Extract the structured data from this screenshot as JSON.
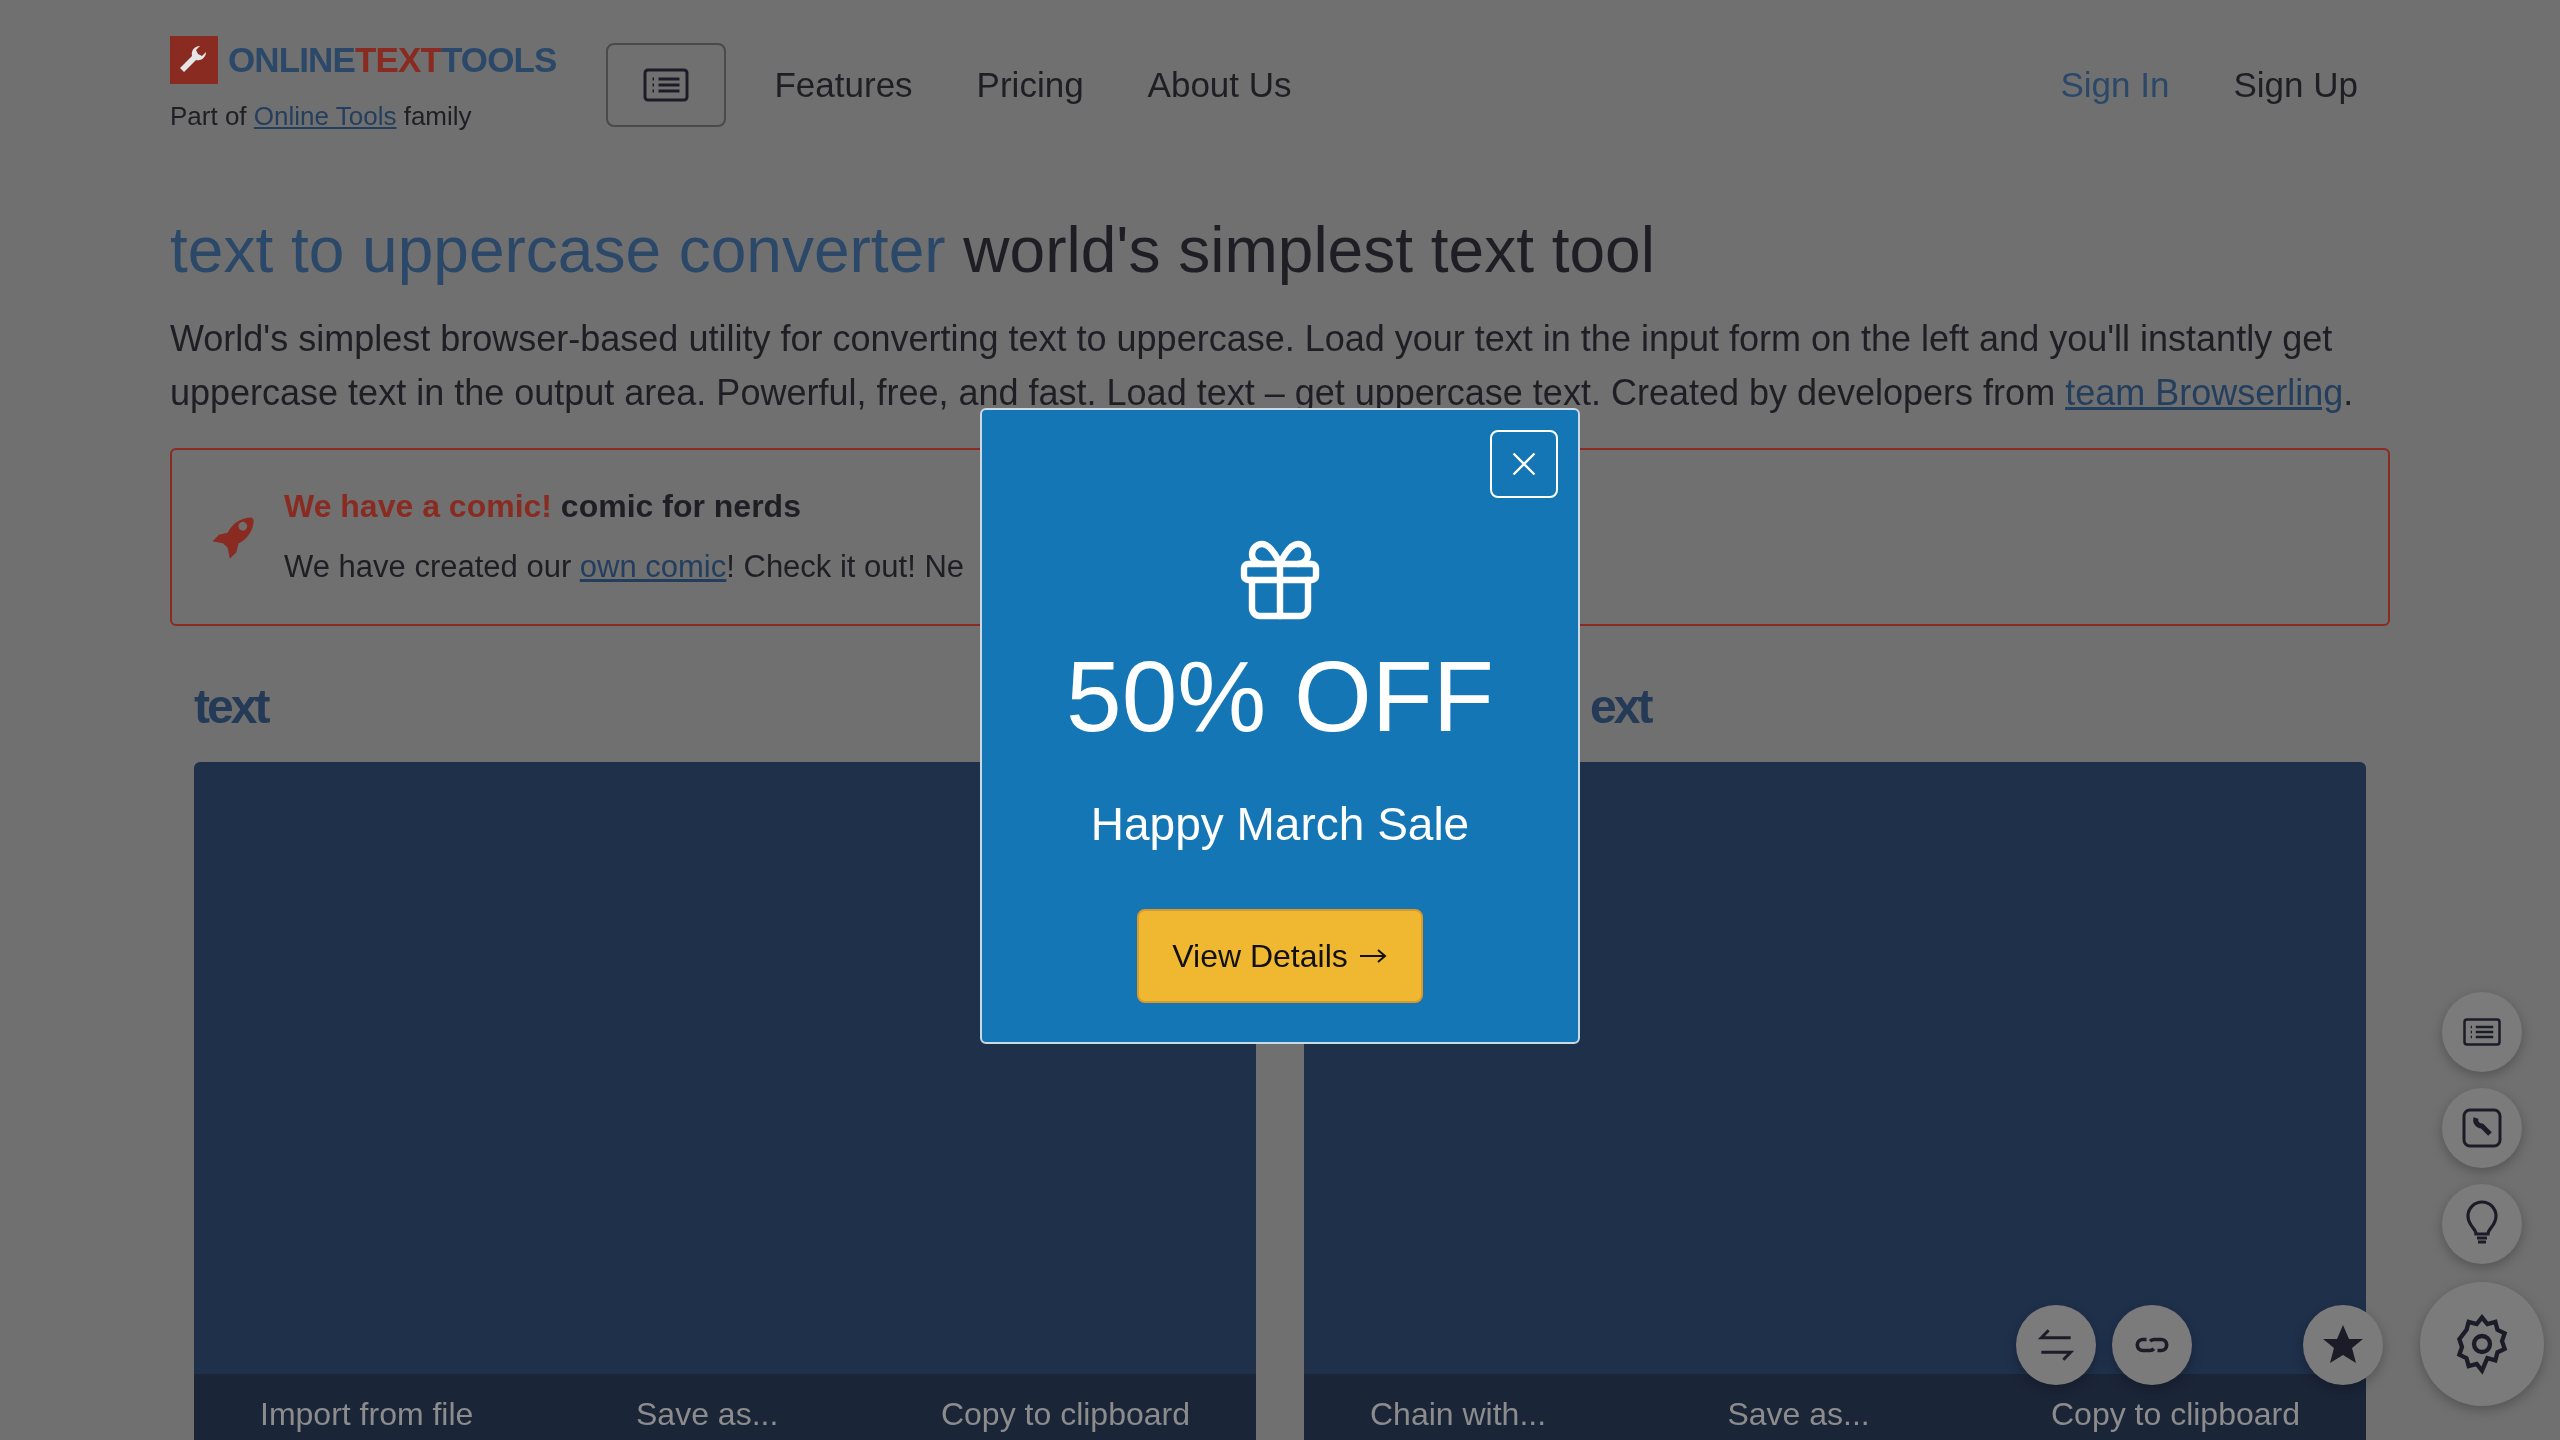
{
  "header": {
    "logo": [
      {
        "text": "ONLINE",
        "color": "#2b4869"
      },
      {
        "text": "TEXT",
        "color": "#8a2b22"
      },
      {
        "text": "TOOLS",
        "color": "#2b4869"
      }
    ],
    "family": {
      "before": "Part of ",
      "link": "Online Tools",
      "after": " family"
    },
    "nav": [
      "Features",
      "Pricing",
      "About Us"
    ],
    "auth": [
      {
        "label": "Sign In",
        "kind": "link"
      },
      {
        "label": "Sign Up",
        "kind": "plain"
      }
    ]
  },
  "title": {
    "highlight": "text to uppercase converter",
    "rest": "world's simplest text tool"
  },
  "description": {
    "before": "World's simplest browser-based utility for converting text to uppercase. Load your text in the input form on the left and you'll instantly get uppercase text in the output area. Powerful, free, and fast. Load text – get uppercase text. Created by developers from ",
    "link": "team Browserling",
    "after": "."
  },
  "banner": {
    "title": "We have a comic!",
    "subtitle": "comic for nerds",
    "before": "We have created our ",
    "link": "own comic",
    "after": "! Check it out! Ne"
  },
  "panels": [
    {
      "heading": "text",
      "actions": [
        "Import from file",
        "Save as...",
        "Copy to clipboard"
      ]
    },
    {
      "heading": "ext",
      "actions": [
        "Chain with...",
        "Save as...",
        "Copy to clipboard"
      ]
    }
  ],
  "modal": {
    "discount": "50% OFF",
    "caption": "Happy March Sale",
    "button": "View Details"
  }
}
